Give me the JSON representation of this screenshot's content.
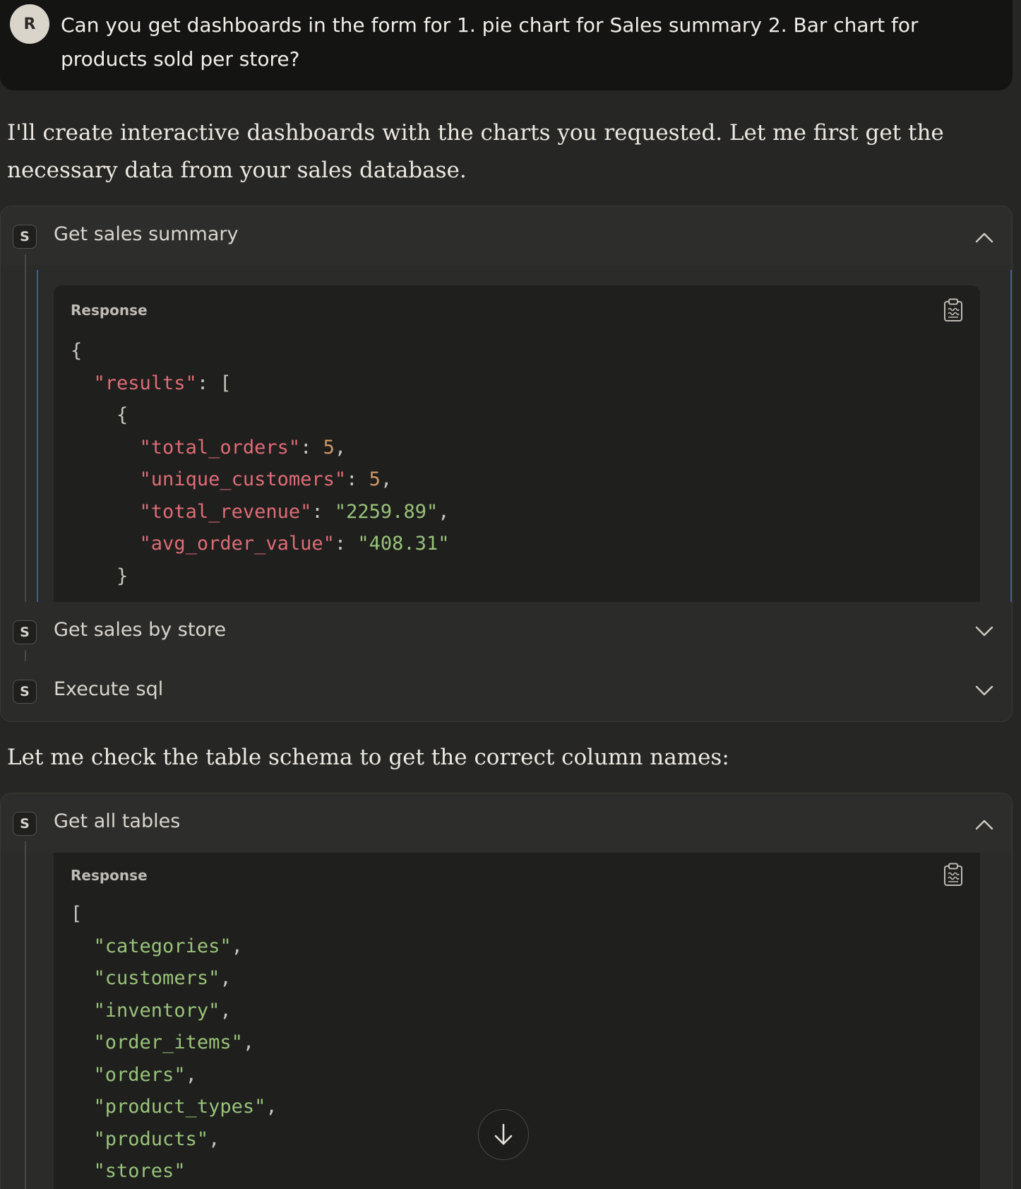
{
  "user_message": {
    "avatar_initial": "R",
    "text": "Can you get dashboards in the form for 1. pie chart for Sales summary 2. Bar chart for products sold per store?"
  },
  "assistant": {
    "intro": "I'll create interactive dashboards with the charts you requested. Let me first get the necessary data from your sales database.",
    "followup": "Let me check the table schema to get the correct column names:"
  },
  "tool_calls_1": [
    {
      "badge": "S",
      "title": "Get sales summary",
      "expanded": true,
      "response_label": "Response",
      "response": {
        "total_orders": "5",
        "unique_customers": "5",
        "total_revenue": "\"2259.89\"",
        "avg_order_value": "\"408.31\""
      }
    },
    {
      "badge": "S",
      "title": "Get sales by store",
      "expanded": false
    },
    {
      "badge": "S",
      "title": "Execute sql",
      "expanded": false
    }
  ],
  "tool_calls_2": [
    {
      "badge": "S",
      "title": "Get all tables",
      "expanded": true,
      "response_label": "Response",
      "tables": [
        "categories",
        "customers",
        "inventory",
        "order_items",
        "orders",
        "product_types",
        "products",
        "stores"
      ]
    }
  ],
  "icons": {
    "copy": "clipboard-icon",
    "collapse": "chevron-up-icon",
    "expand": "chevron-down-icon",
    "scroll_down": "arrow-down-icon"
  },
  "colors": {
    "key": "#e06c75",
    "string": "#98c379",
    "number": "#d19a66",
    "accent_line": "#3e5f9c"
  }
}
